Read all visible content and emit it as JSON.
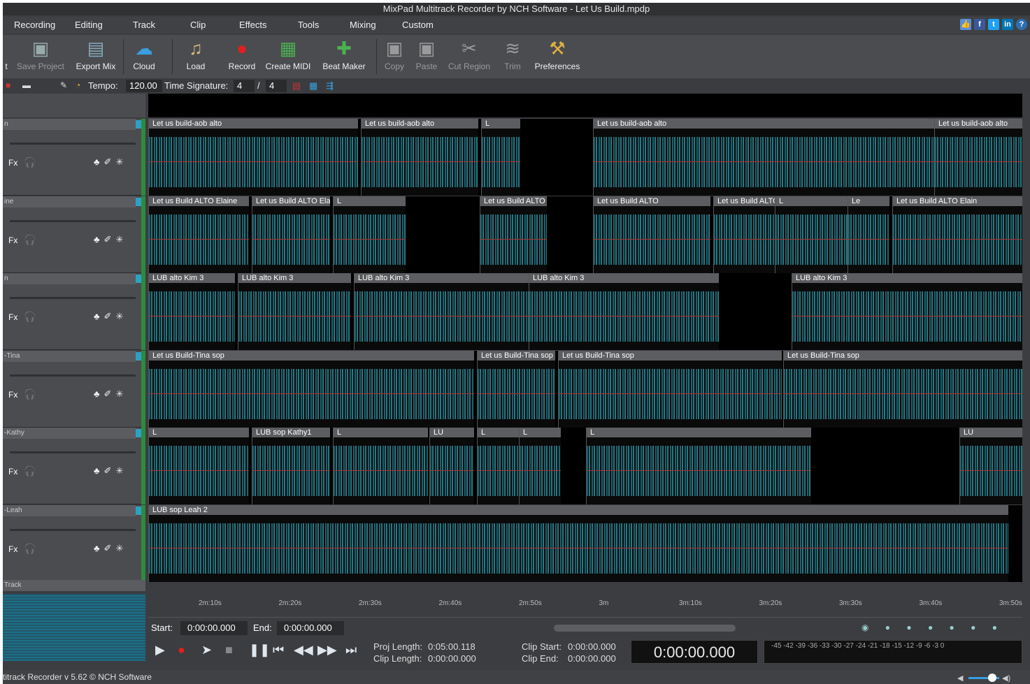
{
  "window": {
    "title": "MixPad Multitrack Recorder by NCH Software - Let Us Build.mpdp"
  },
  "menu": [
    "Recording",
    "Editing",
    "Track",
    "Clip",
    "Effects",
    "Tools",
    "Mixing",
    "Custom"
  ],
  "toolbar": {
    "items": [
      {
        "label": "t",
        "icon": "truncated-icon",
        "enabled": true
      },
      {
        "label": "Save Project",
        "icon": "save-icon",
        "enabled": false
      },
      {
        "label": "Export Mix",
        "icon": "export-icon",
        "enabled": true
      },
      {
        "label": "Cloud",
        "icon": "cloud-icon",
        "enabled": true
      },
      {
        "label": "Load",
        "icon": "load-icon",
        "enabled": true
      },
      {
        "label": "Record",
        "icon": "record-icon",
        "enabled": true
      },
      {
        "label": "Create MIDI",
        "icon": "midi-icon",
        "enabled": true
      },
      {
        "label": "Beat Maker",
        "icon": "beatmaker-icon",
        "enabled": true
      },
      {
        "label": "Copy",
        "icon": "copy-icon",
        "enabled": false
      },
      {
        "label": "Paste",
        "icon": "paste-icon",
        "enabled": false
      },
      {
        "label": "Cut Region",
        "icon": "cut-icon",
        "enabled": false
      },
      {
        "label": "Trim",
        "icon": "trim-icon",
        "enabled": false
      },
      {
        "label": "Preferences",
        "icon": "preferences-icon",
        "enabled": true
      }
    ]
  },
  "tempo": {
    "label": "Tempo:",
    "value": "120.00",
    "ts_label": "Time Signature:",
    "ts_num": "4",
    "ts_sep": "/",
    "ts_den": "4"
  },
  "tracks": [
    {
      "name": "n",
      "clips": [
        {
          "label": "Let us build-aob alto"
        },
        {
          "label": "Let us build-aob alto"
        },
        {
          "label": "L"
        },
        {
          "label": "Let us build-aob alto"
        },
        {
          "label": "Let us build-aob alto"
        }
      ]
    },
    {
      "name": "ine",
      "clips": [
        {
          "label": "Let us Build ALTO Elaine"
        },
        {
          "label": "Let us Build ALTO Elaine"
        },
        {
          "label": "L"
        },
        {
          "label": "Let us Build ALTO Elaine"
        },
        {
          "label": "Let us Build ALTO"
        },
        {
          "label": "Let us Build ALTO Elaine"
        },
        {
          "label": "L"
        },
        {
          "label": "Le"
        },
        {
          "label": "Let us Build ALTO Elain"
        }
      ]
    },
    {
      "name": "n",
      "clips": [
        {
          "label": "LUB alto Kim 3"
        },
        {
          "label": "LUB alto Kim 3"
        },
        {
          "label": "LUB alto Kim 3"
        },
        {
          "label": "LUB alto Kim 3"
        },
        {
          "label": "LUB alto Kim 3"
        }
      ]
    },
    {
      "name": "-Tina",
      "clips": [
        {
          "label": "Let us Build-Tina sop"
        },
        {
          "label": "Let us Build-Tina sop"
        },
        {
          "label": "Let us Build-Tina sop"
        },
        {
          "label": "Let us Build-Tina sop"
        }
      ]
    },
    {
      "name": "-Kathy",
      "clips": [
        {
          "label": "L"
        },
        {
          "label": "LUB sop Kathy1"
        },
        {
          "label": "L"
        },
        {
          "label": "LU"
        },
        {
          "label": "L"
        },
        {
          "label": "L"
        },
        {
          "label": "L"
        },
        {
          "label": "LU"
        }
      ]
    },
    {
      "name": "-Leah",
      "clips": [
        {
          "label": "LUB sop Leah 2"
        }
      ]
    }
  ],
  "track_controls": {
    "fx": "Fx"
  },
  "new_track": "Track",
  "ruler": [
    "2m:10s",
    "2m:20s",
    "2m:30s",
    "2m:40s",
    "2m:50s",
    "3m",
    "3m:10s",
    "3m:20s",
    "3m:30s",
    "3m:40s",
    "3m:50s"
  ],
  "position": {
    "start_label": "Start:",
    "start_value": "0:00:00.000",
    "end_label": "End:",
    "end_value": "0:00:00.000"
  },
  "info": {
    "proj_length_label": "Proj Length:",
    "proj_length": "0:05:00.118",
    "clip_length_label": "Clip Length:",
    "clip_length": "0:00:00.000",
    "clip_start_label": "Clip Start:",
    "clip_start": "0:00:00.000",
    "clip_end_label": "Clip End:",
    "clip_end": "0:00:00.000"
  },
  "big_time": "0:00:00.000",
  "meter_scale": "-45 -42 -39 -36 -33 -30 -27 -24 -21 -18 -15 -12 -9 -6 -3 0",
  "status": "titrack Recorder v 5.62 © NCH Software",
  "colors": {
    "waveform": "#1f6b78",
    "record": "#e02020",
    "accent": "#2ea0c8"
  }
}
